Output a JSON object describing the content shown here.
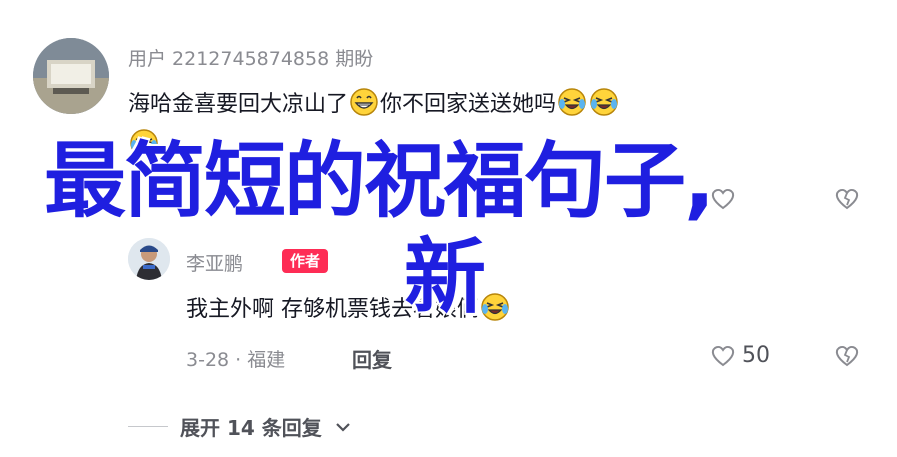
{
  "comment": {
    "username": "用户 2212745874858 期盼",
    "text_part1": "海哈金喜要回大凉山了",
    "text_part2": "你不回家送送她吗"
  },
  "reply": {
    "username": "李亚鹏",
    "badge": "作者",
    "text": "我主外啊 存够机票钱去看娘俩",
    "date_location": "3-28 · 福建",
    "reply_label": "回复",
    "like_count": "50"
  },
  "expand": {
    "label": "展开 14 条回复"
  },
  "overlay": {
    "line1": "最简短的祝福句子,",
    "line2": "新"
  },
  "icons": {
    "grin": "grinning-face-icon",
    "laugh": "laughing-tears-icon",
    "heart": "heart-outline-icon",
    "dislike": "broken-heart-icon",
    "chevron": "chevron-down-icon"
  },
  "colors": {
    "overlay_text": "#1f1fe0",
    "badge_bg": "#fe2c55",
    "muted": "#8a8b91"
  }
}
